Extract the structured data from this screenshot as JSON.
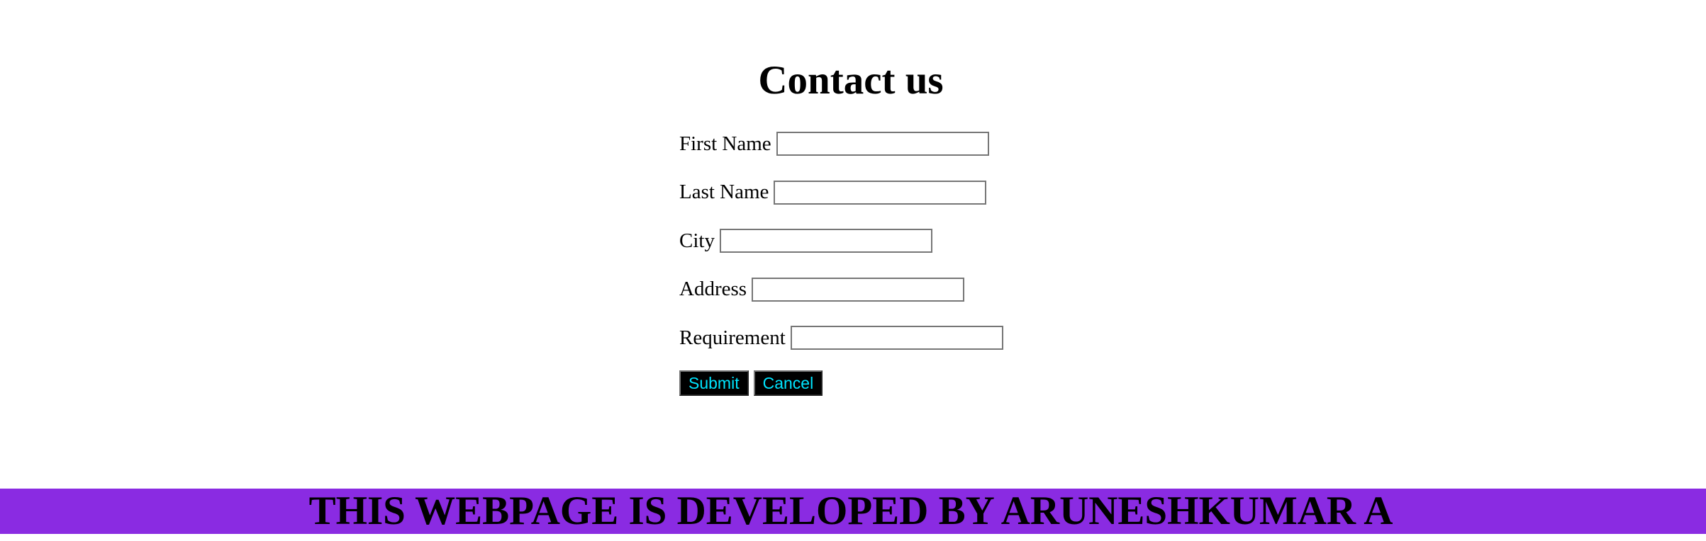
{
  "page": {
    "title": "Contact us"
  },
  "form": {
    "fields": [
      {
        "label": "First Name",
        "value": ""
      },
      {
        "label": "Last Name",
        "value": ""
      },
      {
        "label": "City",
        "value": ""
      },
      {
        "label": "Address",
        "value": ""
      },
      {
        "label": "Requirement",
        "value": ""
      }
    ],
    "submit_label": "Submit",
    "cancel_label": "Cancel"
  },
  "footer": {
    "text": "THIS WEBPAGE IS DEVELOPED BY ARUNESHKUMAR A"
  },
  "colors": {
    "footer_background": "#8a2be2",
    "button_background": "#000000",
    "button_text": "#00e5ff"
  }
}
